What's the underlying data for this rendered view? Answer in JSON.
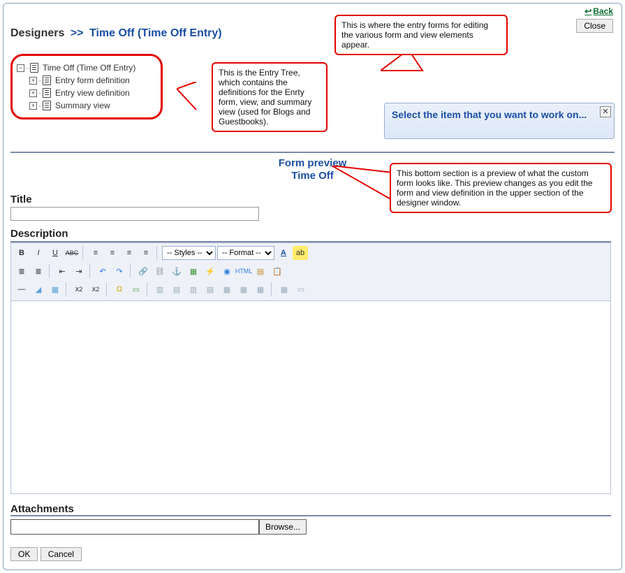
{
  "header": {
    "back_label": "Back",
    "close_label": "Close",
    "breadcrumb_root": "Designers",
    "breadcrumb_sep": ">>",
    "breadcrumb_current": "Time Off (Time Off Entry)"
  },
  "tree": {
    "root": "Time Off (Time Off Entry)",
    "children": [
      "Entry form definition",
      "Entry view definition",
      "Summary view"
    ]
  },
  "callouts": {
    "tree": "This is the Entry Tree, which contains the definitions for the Enrty form, view, and summary view (used for Blogs and Guestbooks).",
    "editor": "This is where the entry forms for editing the various form and view elements appear.",
    "preview": "This bottom section is a preview of what the custom form looks like. This preview changes as you edit the form and view definition in the upper section of the designer window."
  },
  "editor_panel": {
    "message": "Select the item that you want to work on..."
  },
  "preview": {
    "heading_line1": "Form preview",
    "heading_line2": "Time Off",
    "title_label": "Title",
    "title_value": "",
    "description_label": "Description",
    "attachments_label": "Attachments",
    "browse_label": "Browse...",
    "file_value": ""
  },
  "rte": {
    "style_select": "-- Styles --",
    "format_select": "-- Format --",
    "underline_abbr": "U",
    "bold_abbr": "B",
    "italic_abbr": "I",
    "strike_abbr": "ABC",
    "html_label": "HTML"
  },
  "buttons": {
    "ok": "OK",
    "cancel": "Cancel"
  }
}
